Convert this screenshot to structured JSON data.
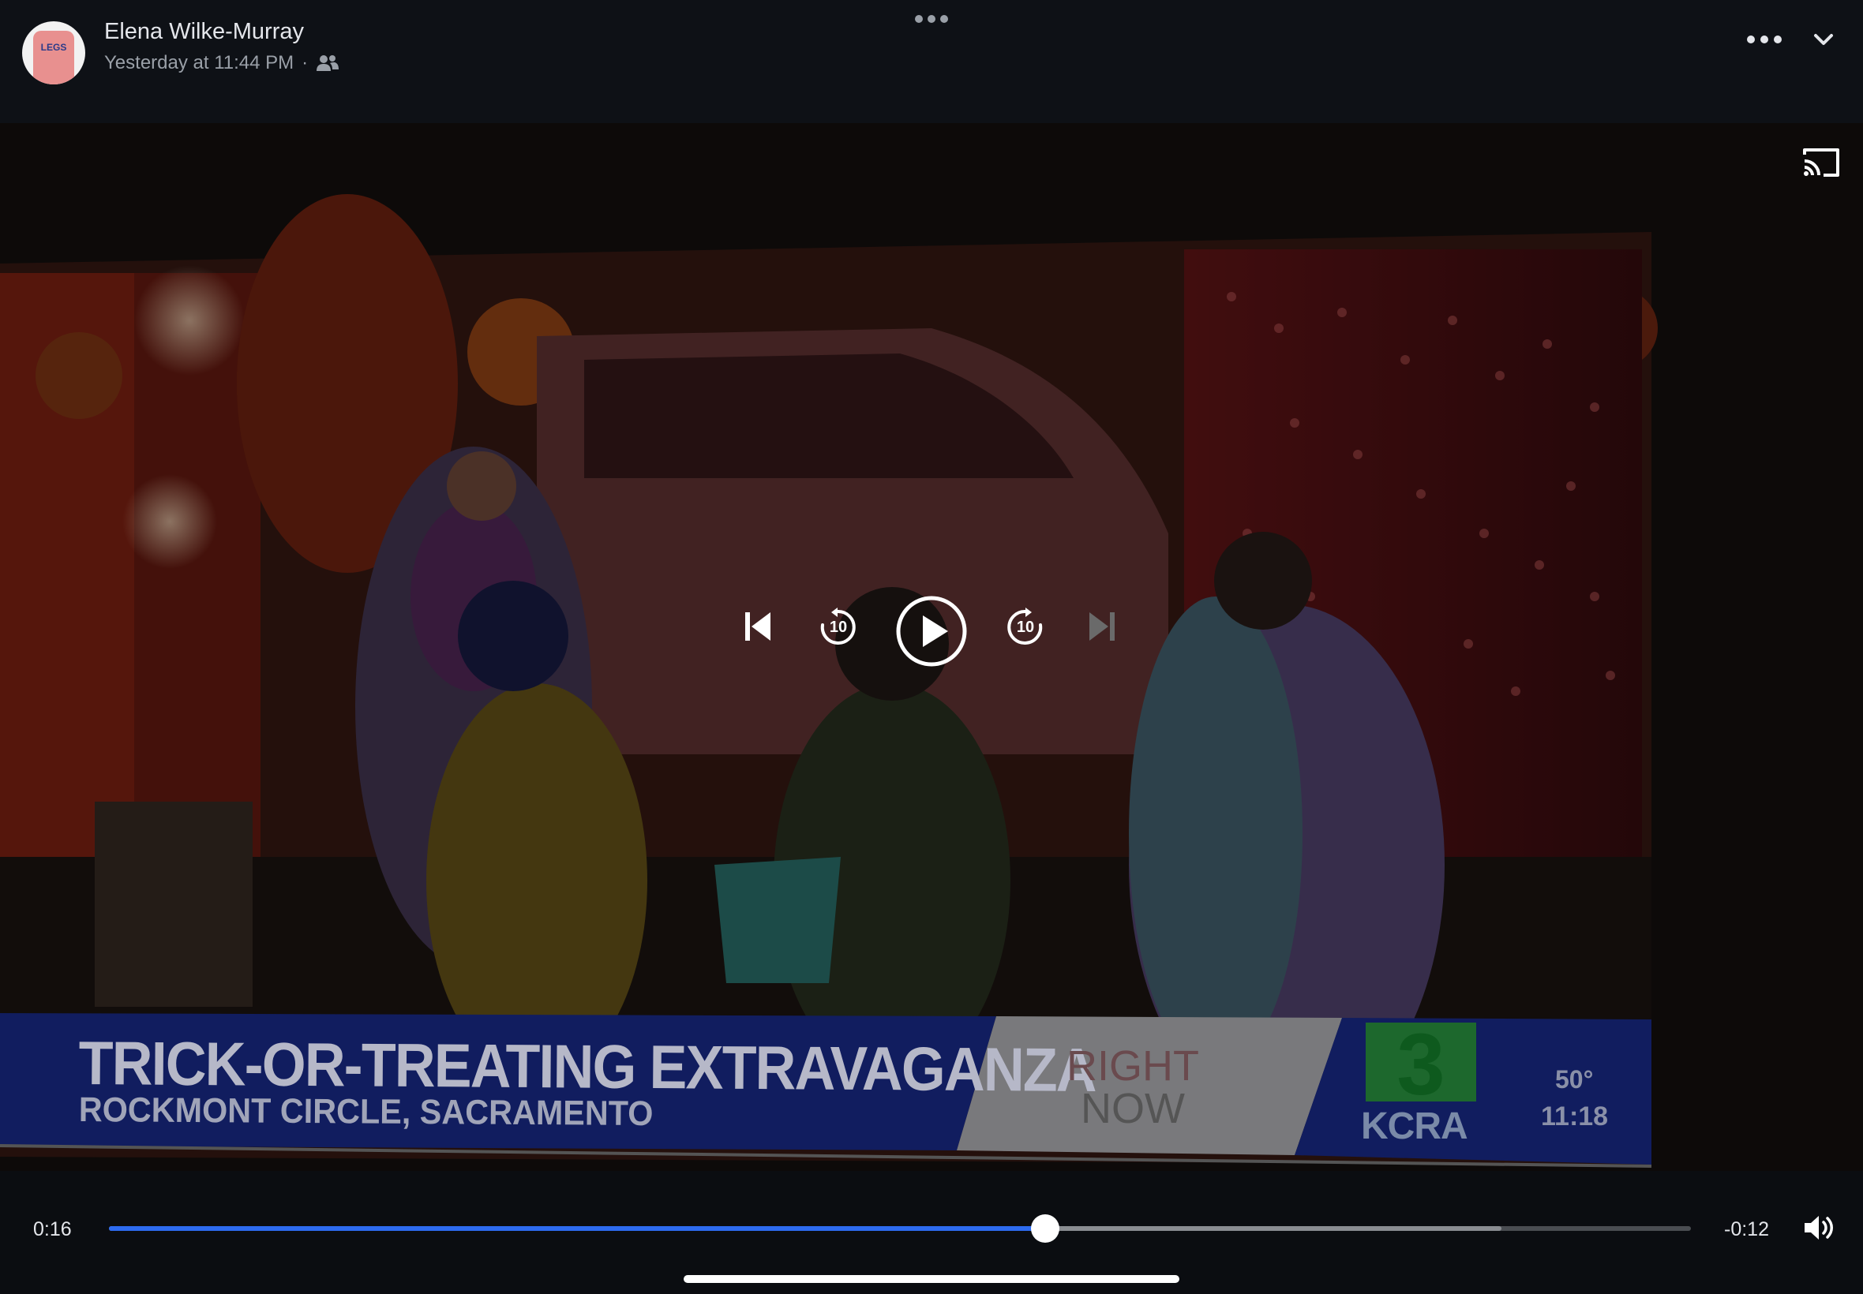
{
  "post": {
    "author_name": "Elena Wilke-Murray",
    "timestamp": "Yesterday at 11:44 PM",
    "separator": "·",
    "audience_icon": "friends-icon",
    "avatar_text": "LEGS"
  },
  "video": {
    "lower_third": {
      "headline": "TRICK-OR-TREATING EXTRAVAGANZA",
      "location": "ROCKMONT CIRCLE, SACRAMENTO",
      "tag_line1": "RIGHT",
      "tag_line2": "NOW",
      "channel_number": "3",
      "station": "KCRA",
      "temperature": "50°",
      "clock": "11:18"
    },
    "controls": {
      "previous_icon": "skip-previous-icon",
      "rewind_icon": "rewind-10-icon",
      "rewind_seconds": "10",
      "play_icon": "play-icon",
      "forward_icon": "forward-10-icon",
      "forward_seconds": "10",
      "next_icon": "skip-next-icon"
    },
    "cast_icon": "cast-icon"
  },
  "playback": {
    "elapsed": "0:16",
    "remaining": "-0:12",
    "progress_fraction": 0.592,
    "buffered_fraction": 0.88,
    "volume_icon": "speaker-icon"
  },
  "colors": {
    "accent": "#2d6bf0",
    "background": "#0b0d11",
    "news_blue": "#1c2f9a",
    "kcra_green": "#2fa84a"
  }
}
